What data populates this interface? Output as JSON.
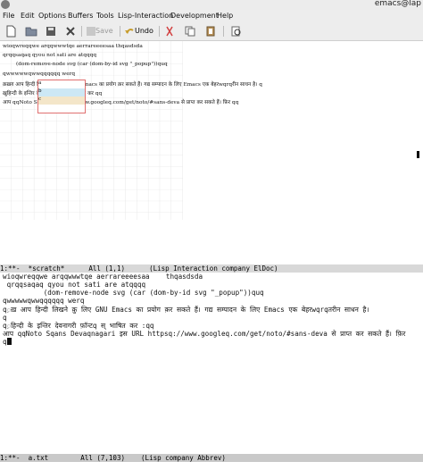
{
  "window": {
    "title": "emacs@lap"
  },
  "menubar": [
    "File",
    "Edit",
    "Options",
    "Buffers",
    "Tools",
    "Lisp-Interaction",
    "Development",
    "Help"
  ],
  "toolbar": {
    "save_label": "Save",
    "undo_label": "Undo"
  },
  "canvas": {
    "lines": [
      "wioqwreqqwe arqqwwwtqe aerrareeeesaa    thqasdsda",
      "qrqqsaqaq qyou not sati are atqqqq",
      "(dom-remove-node svg (car (dom-by-id svg \"_popup\"))quq",
      "qwwwwwqwwqqqqqq werq",
      "क़ख़ग़ आप हिन्दी लिखने क़ु लिए GNU Emacs का प्रयोग क़र सकते हैं। गद्य सम्पादन के लिए Emacs एक बेहरwqrqरीन साधन है। q",
      "ख़ुहिन्दी के इन्तिर देवनागरी फ़ॉन्टq स् भाषित कर  qq",
      "आप qqNoto Sqa          RL httpsq://www.googleq.com/get/noto/#sans-deva से प्राप्त कर सकते हैं। फ़िर qq"
    ],
    "popup_items": [
      "a",
      "b",
      "c"
    ]
  },
  "modeline1": "1:**-  *scratch*      All (1,1)      (Lisp Interaction company ElDoc)",
  "buffer2": {
    "lines": [
      "wioqwreqqwe arqqwwwtqe aerrareeeesaa    thqasdsda",
      " qrqqsaqaq qyou not sati are atqqqq",
      "          (dom-remove-node svg (car (dom-by-id svg \"_popup\"))quq",
      "qwwwwwqwwqqqqqq werq",
      "q़ख़ आप हिन्दी लिखने क़ु लिए GNU Emacs का प्रयोग क़र सकते हैं। गद्य सम्पादन के लिए Emacs एक बेहरwqrqतरीन साधन है। ",
      "q",
      "q़हिन्दी के इन्तिर देवनागरी फ़ॉन्टq स् भाषित कर :qq",
      "आप qqNoto Sqans Devaqnagari इस URL httpsq://www.googleq.com/get/noto/#sans-deva से प्राप्त कर सकते हैं। फ़िर ",
      "q"
    ]
  },
  "modeline2": "1:**-  a.txt        All (7,103)    (Lisp company Abbrev)"
}
